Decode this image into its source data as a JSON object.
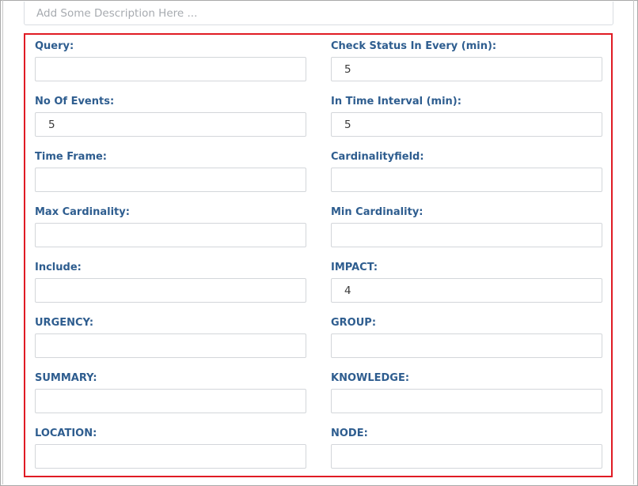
{
  "description": {
    "placeholder": "Add Some Description Here ...",
    "value": ""
  },
  "fields": {
    "query": {
      "label": "Query:",
      "value": ""
    },
    "check_status": {
      "label": "Check Status In Every (min):",
      "value": "5"
    },
    "no_of_events": {
      "label": "No Of Events:",
      "value": "5"
    },
    "time_interval": {
      "label": "In Time Interval (min):",
      "value": "5"
    },
    "time_frame": {
      "label": "Time Frame:",
      "value": ""
    },
    "cardinalityfield": {
      "label": "Cardinalityfield:",
      "value": ""
    },
    "max_cardinality": {
      "label": "Max Cardinality:",
      "value": ""
    },
    "min_cardinality": {
      "label": "Min Cardinality:",
      "value": ""
    },
    "include": {
      "label": "Include:",
      "value": ""
    },
    "impact": {
      "label": "IMPACT:",
      "value": "4"
    },
    "urgency": {
      "label": "URGENCY:",
      "value": ""
    },
    "group": {
      "label": "GROUP:",
      "value": ""
    },
    "summary": {
      "label": "SUMMARY:",
      "value": ""
    },
    "knowledge": {
      "label": "KNOWLEDGE:",
      "value": ""
    },
    "location": {
      "label": "LOCATION:",
      "value": ""
    },
    "node": {
      "label": "NODE:",
      "value": ""
    }
  },
  "colors": {
    "label": "#2e5d8f",
    "highlight_border": "#e01b24",
    "input_border": "#d3d6da"
  }
}
